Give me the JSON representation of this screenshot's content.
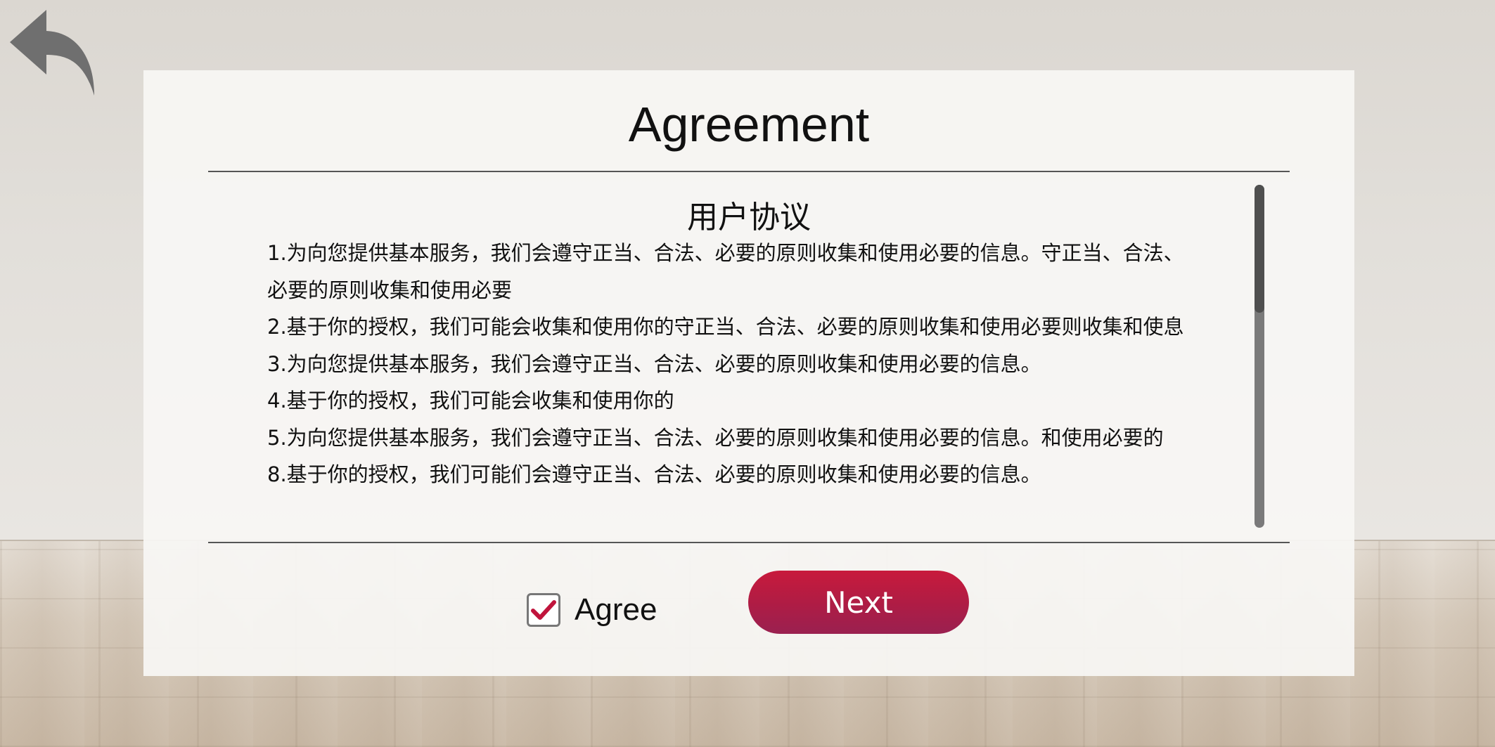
{
  "page": {
    "title": "Agreement"
  },
  "agreement": {
    "heading": "用户协议",
    "lines": [
      "1.为向您提供基本服务，我们会遵守正当、合法、必要的原则收集和使用必要的信息。守正当、合法、",
      "必要的原则收集和使用必要",
      "2.基于你的授权，我们可能会收集和使用你的守正当、合法、必要的原则收集和使用必要则收集和使息",
      "3.为向您提供基本服务，我们会遵守正当、合法、必要的原则收集和使用必要的信息。",
      "4.基于你的授权，我们可能会收集和使用你的",
      "5.为向您提供基本服务，我们会遵守正当、合法、必要的原则收集和使用必要的信息。和使用必要的",
      "8.基于你的授权，我们可能们会遵守正当、合法、必要的原则收集和使用必要的信息。"
    ],
    "scroll_position": 0.0
  },
  "controls": {
    "agree_label": "Agree",
    "agree_checked": true,
    "next_label": "Next"
  },
  "colors": {
    "accent": "#b81c45",
    "check": "#c0143c"
  },
  "icons": {
    "back": "back-arrow-icon",
    "check": "checkmark-icon"
  }
}
